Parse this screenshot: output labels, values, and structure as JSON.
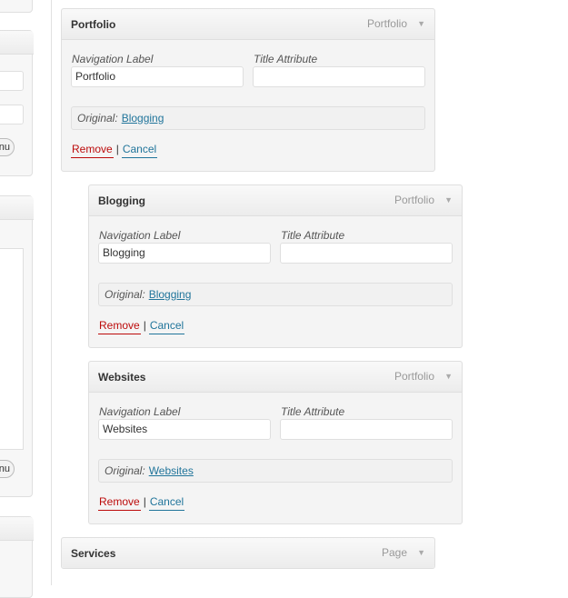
{
  "sidebar": {
    "menu_button_1": "enu",
    "menu_button_2": "enu"
  },
  "menu_items": [
    {
      "title": "Portfolio",
      "type": "Portfolio",
      "arrow": "▼",
      "navigation_label_caption": "Navigation Label",
      "navigation_label_value": "Portfolio",
      "title_attribute_caption": "Title Attribute",
      "title_attribute_value": "",
      "original_label": "Original:",
      "original_link": "Blogging",
      "remove_label": "Remove",
      "separator": "|",
      "cancel_label": "Cancel"
    },
    {
      "title": "Blogging",
      "type": "Portfolio",
      "arrow": "▼",
      "navigation_label_caption": "Navigation Label",
      "navigation_label_value": "Blogging",
      "title_attribute_caption": "Title Attribute",
      "title_attribute_value": "",
      "original_label": "Original:",
      "original_link": "Blogging",
      "remove_label": "Remove",
      "separator": "|",
      "cancel_label": "Cancel"
    },
    {
      "title": "Websites",
      "type": "Portfolio",
      "arrow": "▼",
      "navigation_label_caption": "Navigation Label",
      "navigation_label_value": "Websites",
      "title_attribute_caption": "Title Attribute",
      "title_attribute_value": "",
      "original_label": "Original:",
      "original_link": "Websites",
      "remove_label": "Remove",
      "separator": "|",
      "cancel_label": "Cancel"
    },
    {
      "title": "Services",
      "type": "Page",
      "arrow": "▼"
    }
  ],
  "colors": {
    "link": "#21759b",
    "remove": "#bc0b0b",
    "panel_bg": "#f4f4f4",
    "border": "#dfdfdf"
  }
}
